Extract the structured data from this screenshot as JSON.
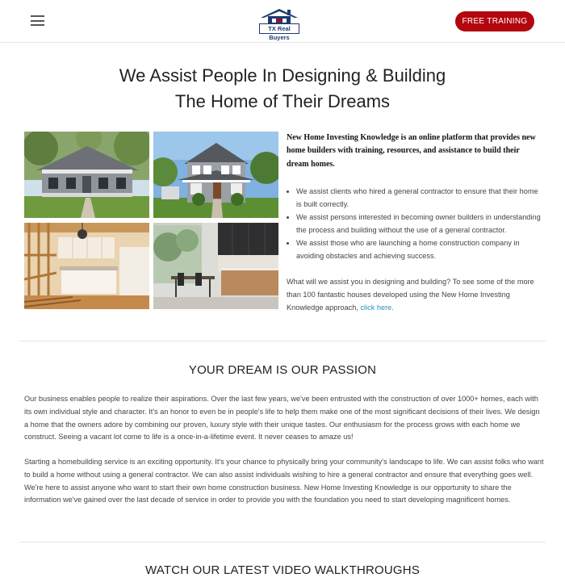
{
  "header": {
    "logo_text": "TX Real Buyers",
    "cta_label": "FREE TRAINING",
    "brand_color": "#b3060f",
    "logo_color": "#1e3a70"
  },
  "hero": {
    "title_line1": "We Assist People In Designing & Building",
    "title_line2": "The Home of Their Dreams"
  },
  "intro": {
    "lead": "New Home Investing Knowledge is an online platform that provides new home builders with training, resources, and assistance to build their dream homes.",
    "bullets": [
      "We assist clients who hired a general contractor to ensure that their home is built correctly.",
      "We assist persons interested in becoming owner builders in understanding the process and building without the use of a general contractor.",
      "We assist those who are launching a home construction company in avoiding obstacles and achieving success."
    ],
    "question": "What will we assist you in designing and building? To see some of the more than 100 fantastic houses developed using the New Home Investing Knowledge approach,",
    "link_text": "click here."
  },
  "gallery": {
    "images": [
      "grey cottage house exterior",
      "two-story craftsman house exterior",
      "kitchen under construction with framing",
      "modern kitchen with dark cabinets"
    ]
  },
  "passion": {
    "title": "YOUR DREAM IS OUR PASSION",
    "paragraph1": "Our business enables people to realize their aspirations. Over the last few years, we've been entrusted with the construction of over 1000+ homes, each with its own individual style and character. It's an honor to even be in people's life to help them make one of the most significant decisions of their lives. We design a home that the owners adore by combining our proven, luxury style with their unique tastes. Our enthusiasm for the process grows with each home we construct. Seeing a vacant lot come to life is a once-in-a-lifetime event. It never ceases to amaze us!",
    "paragraph2": "Starting a homebuilding service is an exciting opportunity. It's your chance to physically bring your community's landscape to life. We can assist folks who want to build a home without using a general contractor. We can also assist individuals wishing to hire a general contractor and ensure that everything goes well. We're here to assist anyone who want to start their own home construction business. New Home Investing Knowledge is our opportunity to share the information we've gained over the last decade of service in order to provide you with the foundation you need to start developing magnificent homes."
  },
  "videos": {
    "title": "WATCH OUR LATEST VIDEO WALKTHROUGHS"
  }
}
